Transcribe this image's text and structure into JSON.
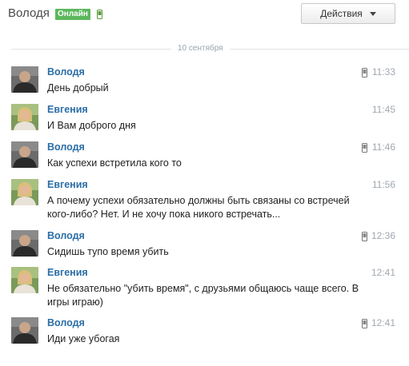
{
  "header": {
    "contact_name": "Володя",
    "status_badge": "Онлайн",
    "actions_label": "Действия"
  },
  "date_separator": "10 сентября",
  "colors": {
    "author": "#2b6ea6",
    "online_badge": "#5cb85c",
    "time": "#a0a8b0"
  },
  "messages": [
    {
      "author": "Володя",
      "time": "11:33",
      "mobile": true,
      "text": "День добрый"
    },
    {
      "author": "Евгения",
      "time": "11:45",
      "mobile": false,
      "text": "И Вам доброго дня"
    },
    {
      "author": "Володя",
      "time": "11:46",
      "mobile": true,
      "text": "Как успехи встретила кого то"
    },
    {
      "author": "Евгения",
      "time": "11:56",
      "mobile": false,
      "text": "А почему успехи обязательно должны быть связаны со встречей кого-либо? Нет. И не хочу пока никого встречать..."
    },
    {
      "author": "Володя",
      "time": "12:36",
      "mobile": true,
      "text": "Сидишь тупо время убить"
    },
    {
      "author": "Евгения",
      "time": "12:41",
      "mobile": false,
      "text": "Не обязательно \"убить время\", с друзьями общаюсь чаще всего. В игры играю)"
    },
    {
      "author": "Володя",
      "time": "12:41",
      "mobile": true,
      "text": "Иди уже убогая"
    }
  ]
}
